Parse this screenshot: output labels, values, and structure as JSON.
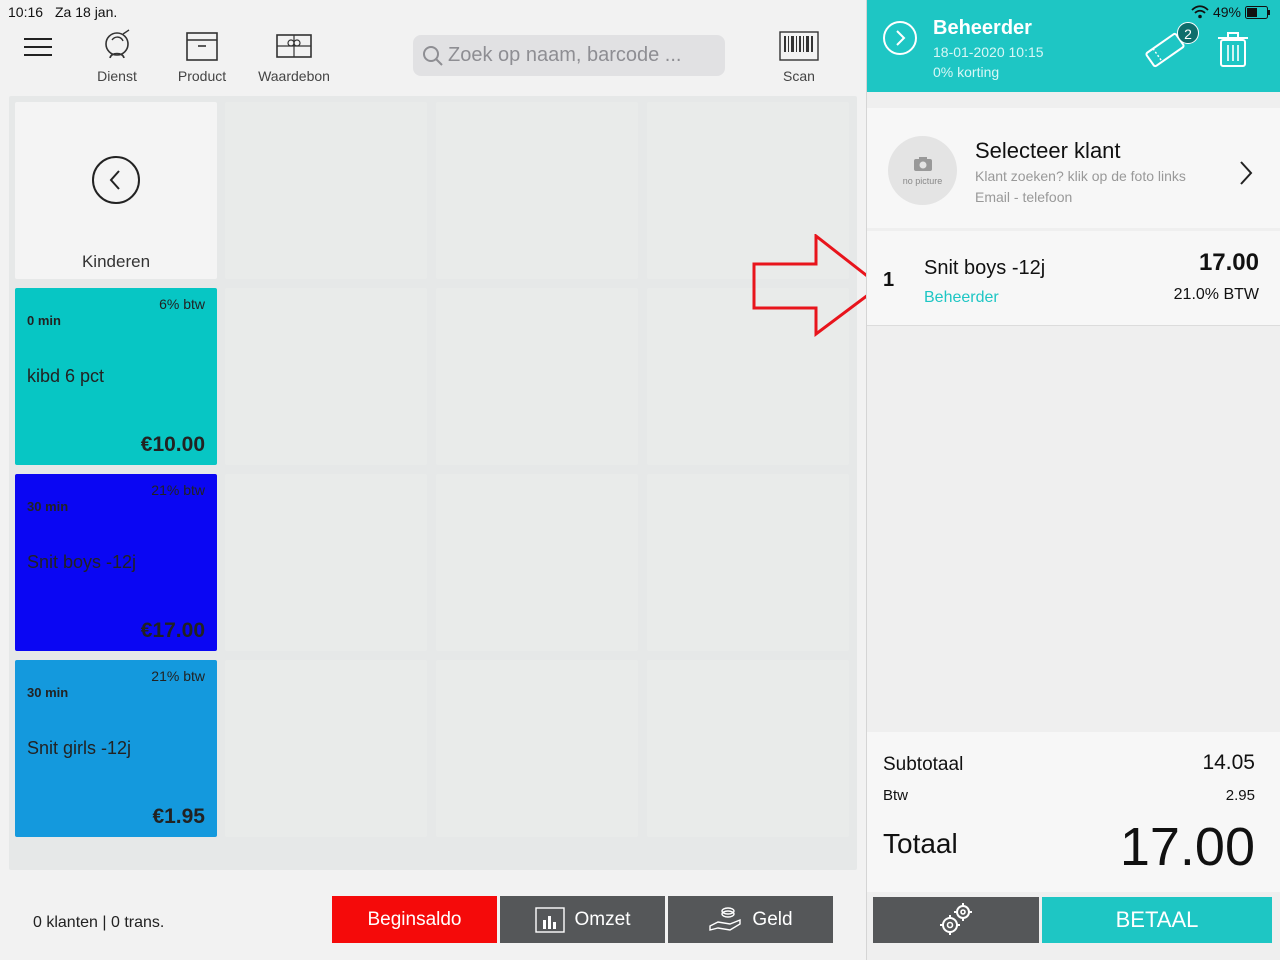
{
  "statusbar": {
    "time": "10:16",
    "date": "Za 18 jan.",
    "battery": "49%"
  },
  "toolbar": {
    "items": [
      {
        "label": "Dienst",
        "icon": "service-icon"
      },
      {
        "label": "Product",
        "icon": "product-box-icon"
      },
      {
        "label": "Waardebon",
        "icon": "gift-voucher-icon"
      }
    ],
    "search_placeholder": "Zoek op naam, barcode ...",
    "scan_label": "Scan"
  },
  "grid": {
    "back_label": "Kinderen",
    "tiles": [
      {
        "btw": "6% btw",
        "duration": "0 min",
        "name": "kibd 6 pct",
        "price": "€10.00",
        "color": "#07c6c4"
      },
      {
        "btw": "21% btw",
        "duration": "30 min",
        "name": "Snit boys -12j",
        "price": "€17.00",
        "color": "#0a06f3"
      },
      {
        "btw": "21% btw",
        "duration": "30 min",
        "name": "Snit girls -12j",
        "price": "€1.95",
        "color": "#1499dd"
      }
    ]
  },
  "bottom": {
    "counts": "0 klanten | 0 trans.",
    "begin_label": "Beginsaldo",
    "omzet_label": "Omzet",
    "geld_label": "Geld"
  },
  "cart": {
    "user": "Beheerder",
    "timestamp": "18-01-2020 10:15",
    "discount": "0% korting",
    "voucher_count": "2",
    "customer": {
      "title": "Selecteer klant",
      "hint": "Klant zoeken? klik op de foto links",
      "sub": "Email - telefoon",
      "avatar_text": "no picture"
    },
    "line": {
      "qty": "1",
      "name": "Snit boys -12j",
      "employee": "Beheerder",
      "price": "17.00",
      "vat": "21.0% BTW"
    },
    "subtotal_label": "Subtotaal",
    "subtotal": "14.05",
    "btw_label": "Btw",
    "btw": "2.95",
    "total_label": "Totaal",
    "total": "17.00",
    "pay_label": "BETAAL"
  },
  "colors": {
    "accent": "#1ec6c4",
    "danger": "#f50a0a",
    "dark_button": "#555759",
    "annotation": "#e8141c"
  }
}
